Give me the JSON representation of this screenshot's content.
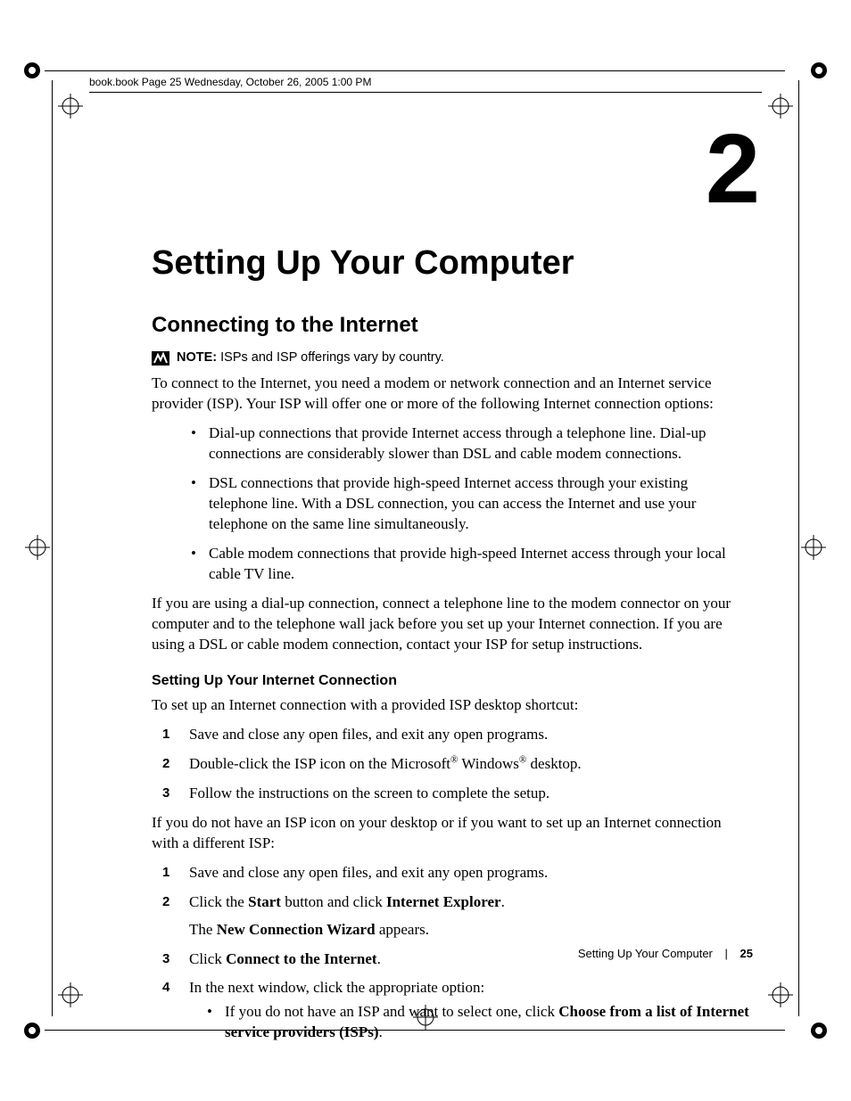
{
  "running_head": "book.book  Page 25  Wednesday, October 26, 2005  1:00 PM",
  "chapter_number": "2",
  "h1": "Setting Up Your Computer",
  "h2": "Connecting to the Internet",
  "note_label": "NOTE:",
  "note_text": " ISPs and ISP offerings vary by country.",
  "intro": "To connect to the Internet, you need a modem or network connection and an Internet service provider (ISP). Your ISP will offer one or more of the following Internet connection options:",
  "bullets_a": [
    "Dial-up connections that provide Internet access through a telephone line. Dial-up connections are considerably slower than DSL and cable modem connections.",
    "DSL connections that provide high-speed Internet access through your existing telephone line. With a DSL connection, you can access the Internet and use your telephone on the same line simultaneously.",
    "Cable modem connections that provide high-speed Internet access through your local cable TV line."
  ],
  "para_b": "If you are using a dial-up connection, connect a telephone line to the modem connector on your computer and to the telephone wall jack before you set up your Internet connection. If you are using a DSL or cable modem connection, contact your ISP for setup instructions.",
  "h3": "Setting Up Your Internet Connection",
  "para_c": "To set up an Internet connection with a provided ISP desktop shortcut:",
  "steps_a": {
    "s1": "Save and close any open files, and exit any open programs.",
    "s2_pre": "Double-click the ISP icon on the Microsoft",
    "s2_mid": " Windows",
    "s2_post": " desktop.",
    "reg": "®",
    "s3": "Follow the instructions on the screen to complete the setup."
  },
  "para_d": "If you do not have an ISP icon on your desktop or if you want to set up an Internet connection with a different ISP:",
  "steps_b": {
    "s1": "Save and close any open files, and exit any open programs.",
    "s2_pre": "Click the ",
    "s2_b1": "Start",
    "s2_mid": " button and click ",
    "s2_b2": "Internet Explorer",
    "s2_post": ".",
    "s2_line2_pre": "The ",
    "s2_line2_b": "New Connection Wizard",
    "s2_line2_post": " appears.",
    "s3_pre": "Click ",
    "s3_b": "Connect to the Internet",
    "s3_post": ".",
    "s4": "In the next window, click the appropriate option:",
    "s4_bul_pre": "If you do not have an ISP and want to select one, click ",
    "s4_bul_b": "Choose from a list of Internet service providers (ISPs)",
    "s4_bul_post": "."
  },
  "footer": {
    "section": "Setting Up Your Computer",
    "page": "25"
  }
}
